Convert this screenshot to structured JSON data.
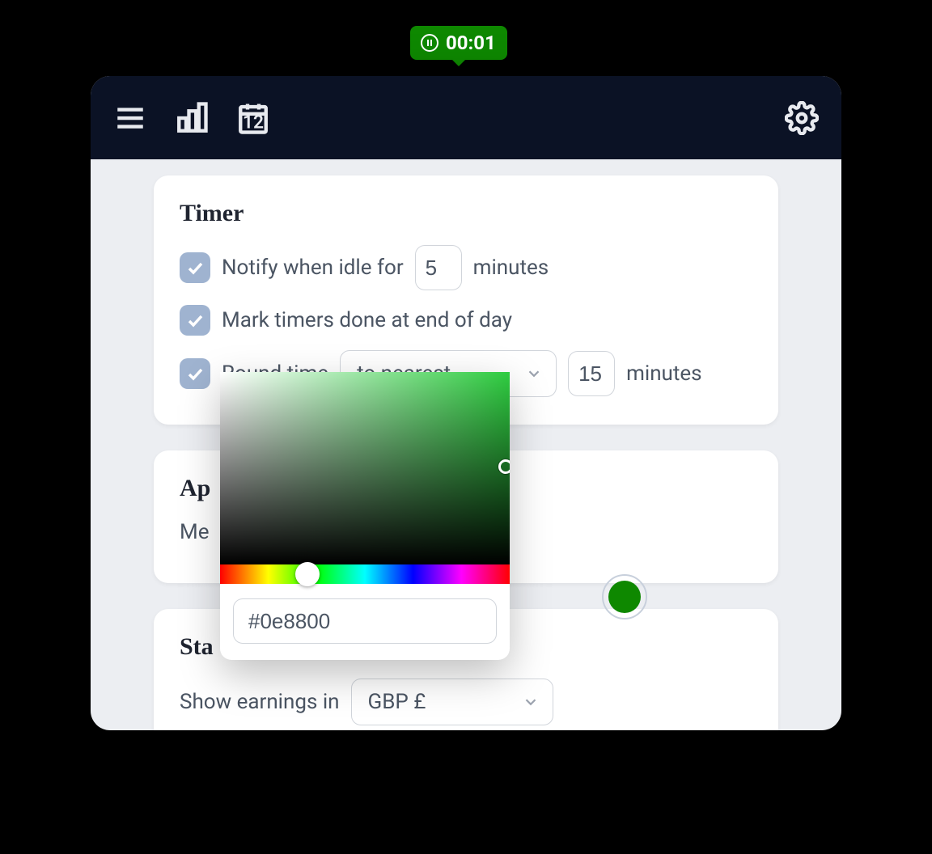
{
  "badge": {
    "time": "00:01"
  },
  "toolbar": {
    "calendar_day": "12"
  },
  "timer": {
    "title": "Timer",
    "idle_label_pre": "Notify when idle for",
    "idle_value": "5",
    "idle_label_post": "minutes",
    "mark_done_label": "Mark timers done at end of day",
    "round_label": "Round time",
    "round_mode": "to nearest",
    "round_value": "15",
    "round_unit": "minutes"
  },
  "appearance": {
    "title_cut": "Ap",
    "row_label_cut": "Me",
    "color_hex": "#0e8800"
  },
  "stats": {
    "title_cut": "Sta",
    "earnings_label": "Show earnings in",
    "currency": "GBP £"
  },
  "picker": {
    "hex_value": "#0e8800"
  }
}
